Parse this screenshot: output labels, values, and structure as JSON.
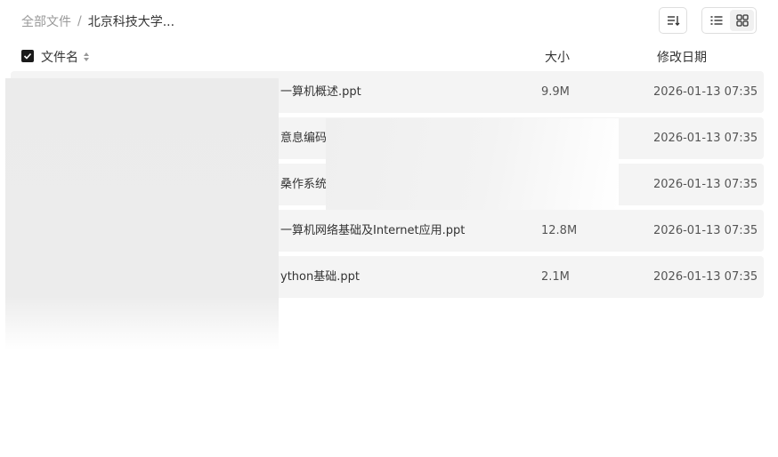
{
  "breadcrumb": {
    "root": "全部文件",
    "separator": "/",
    "current": "北京科技大学..."
  },
  "toolbar": {
    "sort_icon": "sort-icon",
    "list_icon": "list-view-icon",
    "grid_icon": "grid-view-icon",
    "active_view": "list"
  },
  "table": {
    "headers": {
      "name": "文件名",
      "size": "大小",
      "date": "修改日期"
    },
    "rows": [
      {
        "name": "一算机概述.ppt",
        "size": "9.9M",
        "date": "2026-01-13 07:35"
      },
      {
        "name": "意息编码与",
        "size": "",
        "date": "2026-01-13 07:35"
      },
      {
        "name": "桑作系统基",
        "size": "",
        "date": "2026-01-13 07:35"
      },
      {
        "name": "一算机网络基础及Internet应用.ppt",
        "size": "12.8M",
        "date": "2026-01-13 07:35"
      },
      {
        "name": "ython基础.ppt",
        "size": "2.1M",
        "date": "2026-01-13 07:35"
      }
    ]
  }
}
